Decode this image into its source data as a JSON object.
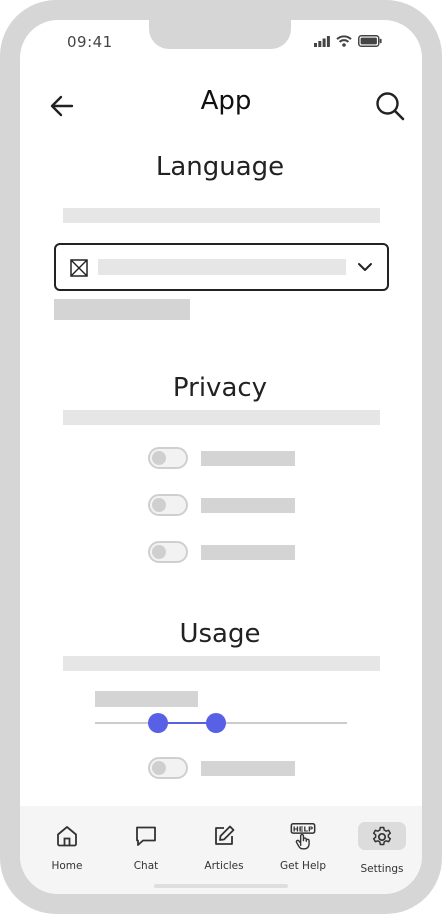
{
  "status_bar": {
    "time": "09:41"
  },
  "header": {
    "title": "App"
  },
  "sections": {
    "language": {
      "title": "Language"
    },
    "privacy": {
      "title": "Privacy"
    },
    "usage": {
      "title": "Usage"
    }
  },
  "usage_slider": {
    "range_low": 0.25,
    "range_high": 0.48
  },
  "tabbar": {
    "items": [
      {
        "label": "Home",
        "icon": "home-icon"
      },
      {
        "label": "Chat",
        "icon": "chat-icon"
      },
      {
        "label": "Articles",
        "icon": "edit-icon"
      },
      {
        "label": "Get Help",
        "icon": "help-icon"
      },
      {
        "label": "Settings",
        "icon": "gear-icon",
        "active": true
      }
    ]
  },
  "colors": {
    "accent": "#5860e6",
    "frame": "#d6d6d6",
    "placeholder": "#e6e6e6"
  }
}
